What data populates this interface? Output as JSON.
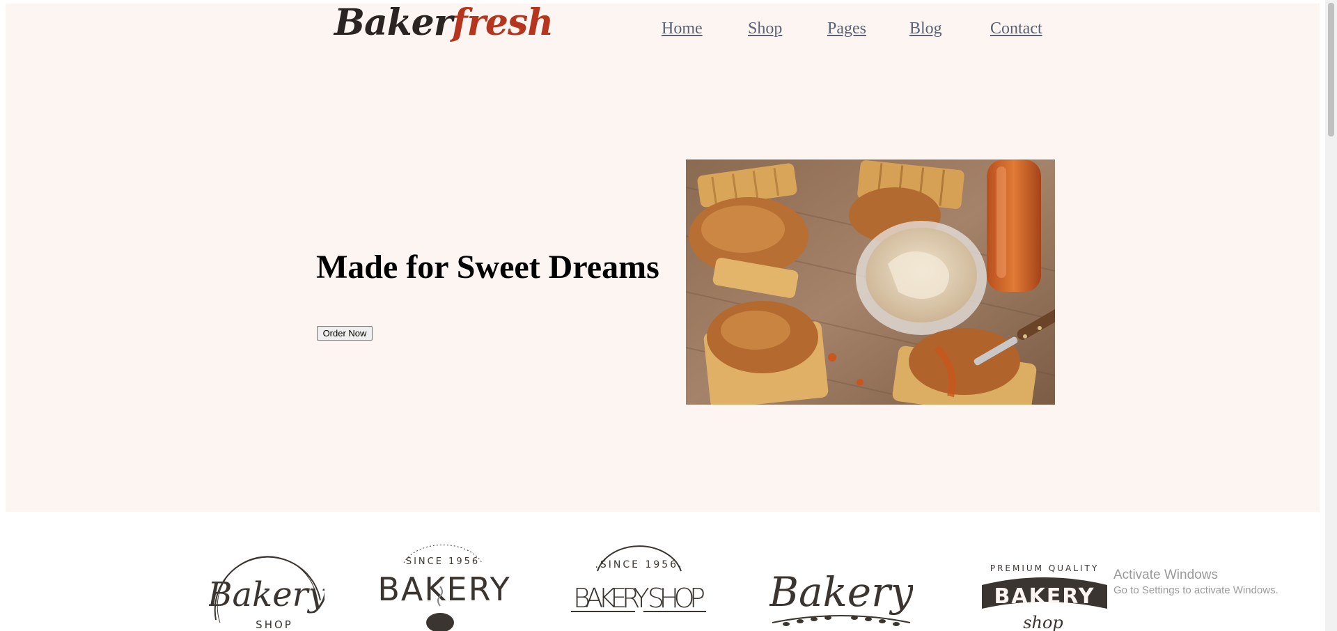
{
  "logo": {
    "part1": "Baker",
    "part2": "fresh"
  },
  "nav": {
    "items": [
      "Home",
      "Shop",
      "Pages",
      "Blog",
      "Contact"
    ]
  },
  "hero": {
    "headline": "Made for Sweet Dreams",
    "cta_label": "Order Now",
    "image_alt": "Fried chicken on waffles with a bowl of dip and a bottle of hot sauce"
  },
  "brands": [
    {
      "main": "Bakery",
      "sub": "SHOP"
    },
    {
      "top": "SINCE 1956",
      "main": "BAKERY"
    },
    {
      "top": ".SINCE 1956.",
      "main": "BAKERY SHOP"
    },
    {
      "main": "Bakery"
    },
    {
      "top": "PREMIUM QUALITY",
      "main": "BAKERY",
      "sub": "shop"
    }
  ],
  "os_notice": {
    "title": "Activate Windows",
    "subtitle": "Go to Settings to activate Windows."
  },
  "colors": {
    "hero_bg": "#fdf5f1",
    "logo_dark": "#2a2522",
    "logo_accent": "#b5351e",
    "nav_link": "#5b6276",
    "brand_ink": "#3a3530"
  }
}
